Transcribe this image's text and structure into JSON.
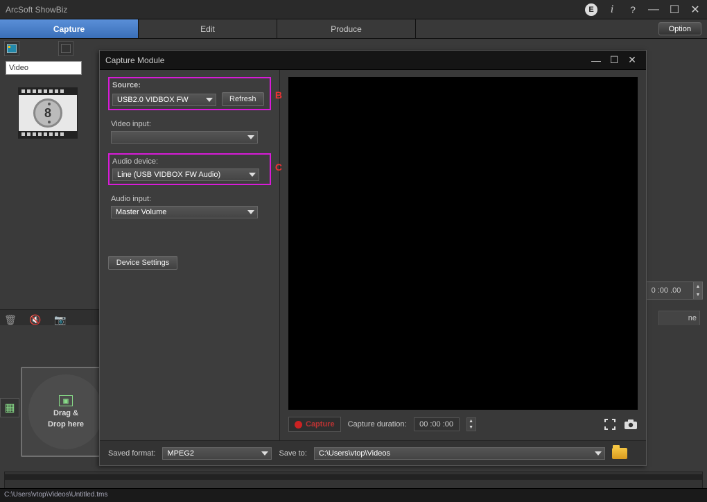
{
  "app": {
    "title": "ArcSoft ShowBiz"
  },
  "titlebar_icons": {
    "e": "E",
    "info": "i",
    "help": "?"
  },
  "tabs": {
    "capture": "Capture",
    "edit": "Edit",
    "produce": "Produce",
    "option": "Option"
  },
  "media": {
    "filter": "Video",
    "thumb_num": "8"
  },
  "drop": {
    "label1": "Drag &",
    "label2": "Drop here"
  },
  "timecode_right": "0 :00 .00",
  "right_tab": "ne",
  "statusbar": "C:\\Users\\vtop\\Videos\\Untitled.tms",
  "modal": {
    "title": "Capture Module",
    "source": {
      "label": "Source:",
      "value": "USB2.0 VIDBOX FW",
      "refresh": "Refresh",
      "callout": "B"
    },
    "video_input": {
      "label": "Video input:",
      "value": ""
    },
    "audio_device": {
      "label": "Audio device:",
      "value": "Line (USB VIDBOX FW Audio)",
      "callout": "C"
    },
    "audio_input": {
      "label": "Audio input:",
      "value": "Master Volume"
    },
    "device_settings": "Device Settings",
    "capture_btn": "Capture",
    "capture_duration_lbl": "Capture duration:",
    "capture_duration_val": "00 :00 :00"
  },
  "footer": {
    "saved_fmt_lbl": "Saved format:",
    "saved_fmt": "MPEG2",
    "save_to_lbl": "Save to:",
    "save_to": "C:\\Users\\vtop\\Videos"
  }
}
